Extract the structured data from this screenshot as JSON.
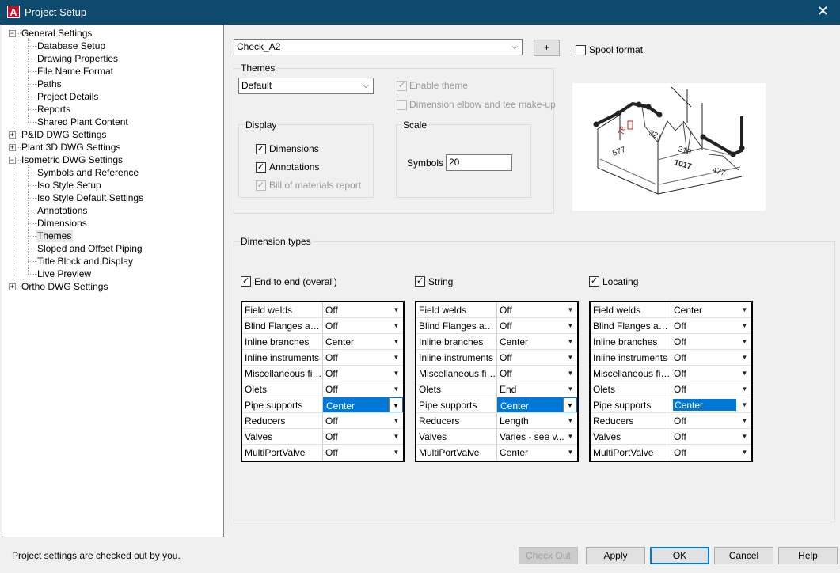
{
  "window": {
    "title": "Project Setup"
  },
  "tree": [
    {
      "label": "General Settings",
      "level": 0,
      "expander": "minus"
    },
    {
      "label": "Database Setup",
      "level": 1
    },
    {
      "label": "Drawing Properties",
      "level": 1
    },
    {
      "label": "File Name Format",
      "level": 1
    },
    {
      "label": "Paths",
      "level": 1
    },
    {
      "label": "Project Details",
      "level": 1
    },
    {
      "label": "Reports",
      "level": 1
    },
    {
      "label": "Shared Plant Content",
      "level": 1
    },
    {
      "label": "P&ID DWG Settings",
      "level": 0,
      "expander": "plus"
    },
    {
      "label": "Plant 3D DWG Settings",
      "level": 0,
      "expander": "plus"
    },
    {
      "label": "Isometric DWG Settings",
      "level": 0,
      "expander": "minus"
    },
    {
      "label": "Symbols and Reference",
      "level": 1
    },
    {
      "label": "Iso Style Setup",
      "level": 1
    },
    {
      "label": "Iso Style Default Settings",
      "level": 1
    },
    {
      "label": "Annotations",
      "level": 1
    },
    {
      "label": "Dimensions",
      "level": 1
    },
    {
      "label": "Themes",
      "level": 1,
      "selected": true
    },
    {
      "label": "Sloped and Offset Piping",
      "level": 1
    },
    {
      "label": "Title Block and Display",
      "level": 1
    },
    {
      "label": "Live Preview",
      "level": 1
    },
    {
      "label": "Ortho DWG Settings",
      "level": 0,
      "expander": "plus"
    }
  ],
  "top": {
    "style_combo": "Check_A2",
    "plus_button": "+",
    "spool_format": {
      "label": "Spool format",
      "checked": false
    }
  },
  "themes": {
    "group_label": "Themes",
    "combo": "Default",
    "enable_theme": {
      "label": "Enable theme",
      "checked": true,
      "disabled": true
    },
    "elbow_tee": {
      "label": "Dimension elbow and tee make-up",
      "checked": false,
      "disabled": true
    },
    "display": {
      "group_label": "Display",
      "dimensions": {
        "label": "Dimensions",
        "checked": true
      },
      "annotations": {
        "label": "Annotations",
        "checked": true
      },
      "bom": {
        "label": "Bill of materials report",
        "checked": true,
        "disabled": true
      }
    },
    "scale": {
      "group_label": "Scale",
      "symbols_label": "Symbols",
      "symbols_value": "20"
    }
  },
  "preview": {
    "dims": [
      "76",
      "577",
      "321",
      "219",
      "1017",
      "477"
    ]
  },
  "dimension_types": {
    "group_label": "Dimension types",
    "tables": [
      {
        "label": "End to end (overall)",
        "checked": true,
        "rows": [
          [
            "Field welds",
            "Off"
          ],
          [
            "Blind Flanges and...",
            "Off"
          ],
          [
            "Inline branches",
            "Center"
          ],
          [
            "Inline instruments",
            "Off"
          ],
          [
            "Miscellaneous fitti...",
            "Off"
          ],
          [
            "Olets",
            "Off"
          ],
          [
            "Pipe supports",
            "Center"
          ],
          [
            "Reducers",
            "Off"
          ],
          [
            "Valves",
            "Off"
          ],
          [
            "MultiPortValve",
            "Off"
          ]
        ]
      },
      {
        "label": "String",
        "checked": true,
        "rows": [
          [
            "Field welds",
            "Off"
          ],
          [
            "Blind Flanges and...",
            "Off"
          ],
          [
            "Inline branches",
            "Center"
          ],
          [
            "Inline instruments",
            "Off"
          ],
          [
            "Miscellaneous fitti...",
            "Off"
          ],
          [
            "Olets",
            "End"
          ],
          [
            "Pipe supports",
            "Center"
          ],
          [
            "Reducers",
            "Length"
          ],
          [
            "Valves",
            "Varies - see v..."
          ],
          [
            "MultiPortValve",
            "Center"
          ]
        ]
      },
      {
        "label": "Locating",
        "checked": true,
        "rows": [
          [
            "Field welds",
            "Center"
          ],
          [
            "Blind Flanges and...",
            "Off"
          ],
          [
            "Inline branches",
            "Off"
          ],
          [
            "Inline instruments",
            "Off"
          ],
          [
            "Miscellaneous fitti...",
            "Off"
          ],
          [
            "Olets",
            "Off"
          ],
          [
            "Pipe supports",
            "Center"
          ],
          [
            "Reducers",
            "Off"
          ],
          [
            "Valves",
            "Off"
          ],
          [
            "MultiPortValve",
            "Off"
          ]
        ]
      }
    ]
  },
  "status": {
    "text": "Project settings are checked out by you."
  },
  "buttons": {
    "check_out": "Check Out",
    "apply": "Apply",
    "ok": "OK",
    "cancel": "Cancel",
    "help": "Help"
  }
}
